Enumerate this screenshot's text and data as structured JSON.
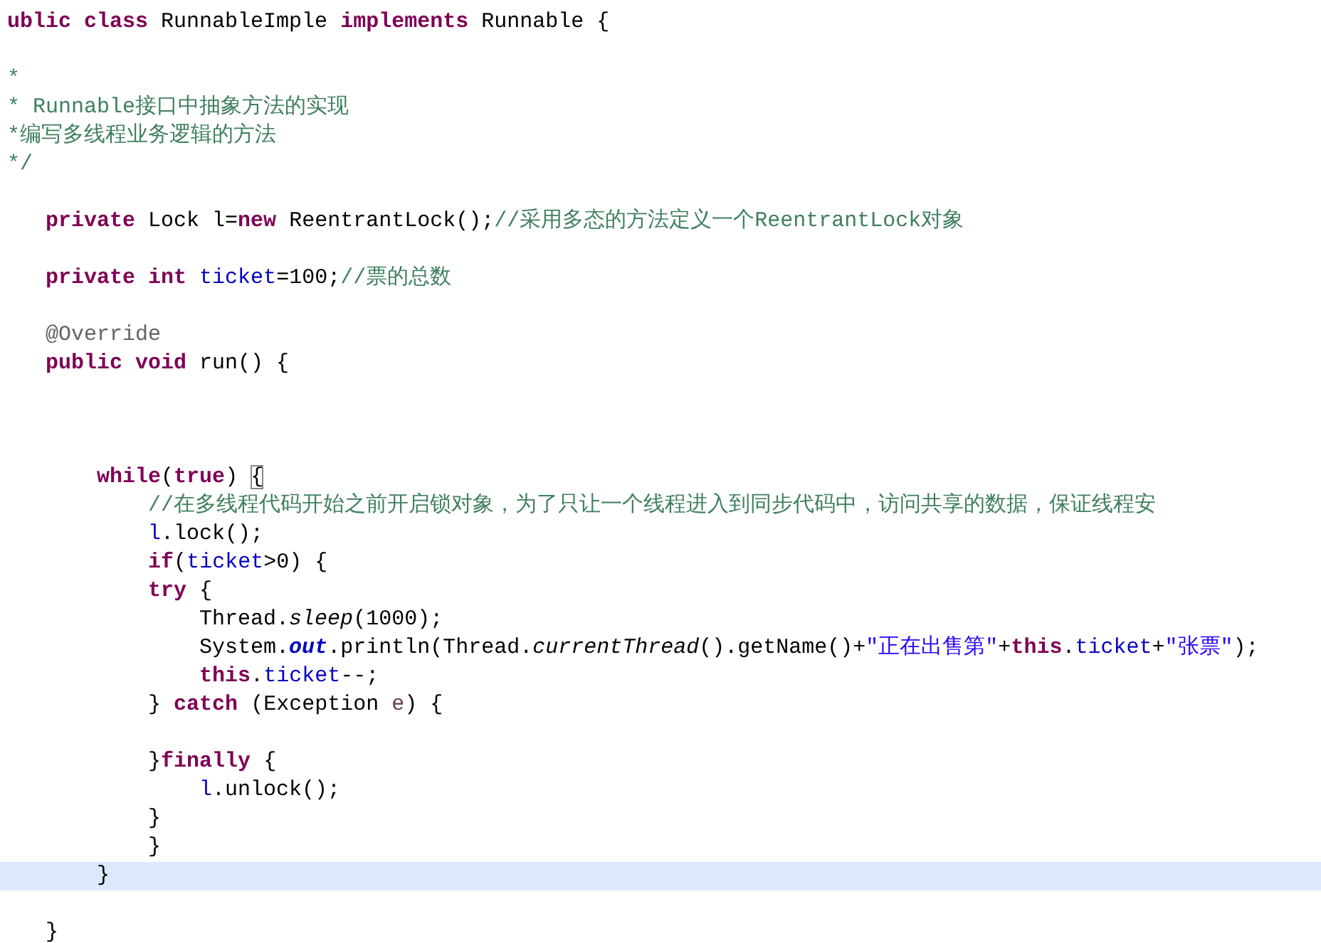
{
  "editor": {
    "lines": [
      {
        "current": false,
        "segments": [
          {
            "kind": "keyword",
            "text": "ublic class"
          },
          {
            "kind": "plain",
            "text": " RunnableImple "
          },
          {
            "kind": "keyword",
            "text": "implements"
          },
          {
            "kind": "plain",
            "text": " Runnable {"
          }
        ]
      },
      {
        "current": false
      },
      {
        "current": false,
        "segments": [
          {
            "kind": "comment",
            "text": "*"
          }
        ]
      },
      {
        "current": false,
        "segments": [
          {
            "kind": "comment",
            "text": "* Runnable接口中抽象方法的实现"
          }
        ]
      },
      {
        "current": false,
        "segments": [
          {
            "kind": "comment",
            "text": "*编写多线程业务逻辑的方法"
          }
        ]
      },
      {
        "current": false,
        "segments": [
          {
            "kind": "comment",
            "text": "*/"
          }
        ]
      },
      {
        "current": false
      },
      {
        "current": false,
        "segments": [
          {
            "kind": "keyword",
            "text": "   private"
          },
          {
            "kind": "plain",
            "text": " Lock l="
          },
          {
            "kind": "keyword",
            "text": "new"
          },
          {
            "kind": "plain",
            "text": " ReentrantLock();"
          },
          {
            "kind": "comment",
            "text": "//采用多态的方法定义一个ReentrantLock对象"
          }
        ]
      },
      {
        "current": false
      },
      {
        "current": false,
        "segments": [
          {
            "kind": "keyword",
            "text": "   private int"
          },
          {
            "kind": "field",
            "text": " ticket"
          },
          {
            "kind": "plain",
            "text": "=100;"
          },
          {
            "kind": "comment",
            "text": "//票的总数"
          }
        ]
      },
      {
        "current": false
      },
      {
        "current": false,
        "segments": [
          {
            "kind": "annotation",
            "text": "   @Override"
          }
        ]
      },
      {
        "current": false,
        "segments": [
          {
            "kind": "keyword",
            "text": "   public void"
          },
          {
            "kind": "plain",
            "text": " run() {"
          }
        ]
      },
      {
        "current": false
      },
      {
        "current": false
      },
      {
        "current": false
      },
      {
        "current": false,
        "segments": [
          {
            "kind": "keyword",
            "text": "       while"
          },
          {
            "kind": "plain",
            "text": "("
          },
          {
            "kind": "keyword",
            "text": "true"
          },
          {
            "kind": "plain",
            "text": ") "
          },
          {
            "kind": "matched-bracket",
            "text": "{"
          }
        ]
      },
      {
        "current": false,
        "segments": [
          {
            "kind": "comment",
            "text": "           //在多线程代码开始之前开启锁对象，为了只让一个线程进入到同步代码中，访问共享的数据，保证线程安"
          }
        ]
      },
      {
        "current": false,
        "segments": [
          {
            "kind": "field",
            "text": "           l"
          },
          {
            "kind": "plain",
            "text": ".lock();"
          }
        ]
      },
      {
        "current": false,
        "segments": [
          {
            "kind": "keyword",
            "text": "           if"
          },
          {
            "kind": "plain",
            "text": "("
          },
          {
            "kind": "field",
            "text": "ticket"
          },
          {
            "kind": "plain",
            "text": ">0) {"
          }
        ]
      },
      {
        "current": false,
        "segments": [
          {
            "kind": "keyword",
            "text": "           try"
          },
          {
            "kind": "plain",
            "text": " {"
          }
        ]
      },
      {
        "current": false,
        "segments": [
          {
            "kind": "plain",
            "text": "               Thread."
          },
          {
            "kind": "static-method",
            "text": "sleep"
          },
          {
            "kind": "plain",
            "text": "(1000);"
          }
        ]
      },
      {
        "current": false,
        "segments": [
          {
            "kind": "plain",
            "text": "               System."
          },
          {
            "kind": "static-field",
            "text": "out"
          },
          {
            "kind": "plain",
            "text": ".println(Thread."
          },
          {
            "kind": "static-method",
            "text": "currentThread"
          },
          {
            "kind": "plain",
            "text": "().getName()+"
          },
          {
            "kind": "string",
            "text": "\"正在出售第\""
          },
          {
            "kind": "plain",
            "text": "+"
          },
          {
            "kind": "keyword",
            "text": "this"
          },
          {
            "kind": "plain",
            "text": "."
          },
          {
            "kind": "field",
            "text": "ticket"
          },
          {
            "kind": "plain",
            "text": "+"
          },
          {
            "kind": "string",
            "text": "\"张票\""
          },
          {
            "kind": "plain",
            "text": ");"
          }
        ]
      },
      {
        "current": false,
        "segments": [
          {
            "kind": "keyword",
            "text": "               this"
          },
          {
            "kind": "plain",
            "text": "."
          },
          {
            "kind": "field",
            "text": "ticket"
          },
          {
            "kind": "plain",
            "text": "--;"
          }
        ]
      },
      {
        "current": false,
        "segments": [
          {
            "kind": "plain",
            "text": "           } "
          },
          {
            "kind": "keyword",
            "text": "catch"
          },
          {
            "kind": "plain",
            "text": " (Exception "
          },
          {
            "kind": "local",
            "text": "e"
          },
          {
            "kind": "plain",
            "text": ") {"
          }
        ]
      },
      {
        "current": false
      },
      {
        "current": false,
        "segments": [
          {
            "kind": "plain",
            "text": "           }"
          },
          {
            "kind": "keyword",
            "text": "finally"
          },
          {
            "kind": "plain",
            "text": " {"
          }
        ]
      },
      {
        "current": false,
        "segments": [
          {
            "kind": "field",
            "text": "               l"
          },
          {
            "kind": "plain",
            "text": ".unlock();"
          }
        ]
      },
      {
        "current": false,
        "segments": [
          {
            "kind": "plain",
            "text": "           }"
          }
        ]
      },
      {
        "current": false,
        "segments": [
          {
            "kind": "plain",
            "text": "           }"
          }
        ]
      },
      {
        "current": true,
        "segments": [
          {
            "kind": "plain",
            "text": "       }"
          }
        ]
      },
      {
        "current": false
      },
      {
        "current": false,
        "segments": [
          {
            "kind": "plain",
            "text": "   }"
          }
        ]
      }
    ]
  }
}
